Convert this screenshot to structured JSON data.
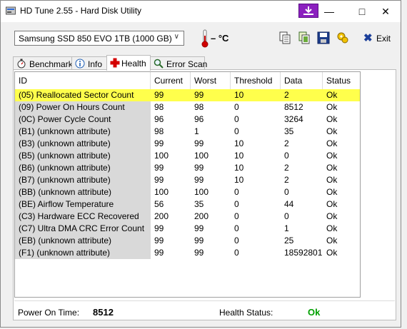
{
  "window": {
    "title": "HD Tune 2.55 - Hard Disk Utility"
  },
  "toolbar": {
    "drive": "Samsung SSD 850 EVO 1TB (1000 GB)",
    "temperature": "– °C",
    "exit_label": "Exit"
  },
  "tabs": [
    {
      "label": "Benchmark",
      "icon": "stopwatch-icon"
    },
    {
      "label": "Info",
      "icon": "info-icon"
    },
    {
      "label": "Health",
      "icon": "red-cross-icon",
      "active": true
    },
    {
      "label": "Error Scan",
      "icon": "magnifier-icon"
    }
  ],
  "table": {
    "headers": [
      "ID",
      "Current",
      "Worst",
      "Threshold",
      "Data",
      "Status"
    ],
    "rows": [
      {
        "id": "(05) Reallocated Sector Count",
        "current": "99",
        "worst": "99",
        "threshold": "10",
        "data": "2",
        "status": "Ok",
        "highlighted": true
      },
      {
        "id": "(09) Power On Hours Count",
        "current": "98",
        "worst": "98",
        "threshold": "0",
        "data": "8512",
        "status": "Ok"
      },
      {
        "id": "(0C) Power Cycle Count",
        "current": "96",
        "worst": "96",
        "threshold": "0",
        "data": "3264",
        "status": "Ok"
      },
      {
        "id": "(B1) (unknown attribute)",
        "current": "98",
        "worst": "1",
        "threshold": "0",
        "data": "35",
        "status": "Ok"
      },
      {
        "id": "(B3) (unknown attribute)",
        "current": "99",
        "worst": "99",
        "threshold": "10",
        "data": "2",
        "status": "Ok"
      },
      {
        "id": "(B5) (unknown attribute)",
        "current": "100",
        "worst": "100",
        "threshold": "10",
        "data": "0",
        "status": "Ok"
      },
      {
        "id": "(B6) (unknown attribute)",
        "current": "99",
        "worst": "99",
        "threshold": "10",
        "data": "2",
        "status": "Ok"
      },
      {
        "id": "(B7) (unknown attribute)",
        "current": "99",
        "worst": "99",
        "threshold": "10",
        "data": "2",
        "status": "Ok"
      },
      {
        "id": "(BB) (unknown attribute)",
        "current": "100",
        "worst": "100",
        "threshold": "0",
        "data": "0",
        "status": "Ok"
      },
      {
        "id": "(BE) Airflow Temperature",
        "current": "56",
        "worst": "35",
        "threshold": "0",
        "data": "44",
        "status": "Ok"
      },
      {
        "id": "(C3) Hardware ECC Recovered",
        "current": "200",
        "worst": "200",
        "threshold": "0",
        "data": "0",
        "status": "Ok"
      },
      {
        "id": "(C7) Ultra DMA CRC Error Count",
        "current": "99",
        "worst": "99",
        "threshold": "0",
        "data": "1",
        "status": "Ok"
      },
      {
        "id": "(EB) (unknown attribute)",
        "current": "99",
        "worst": "99",
        "threshold": "0",
        "data": "25",
        "status": "Ok"
      },
      {
        "id": "(F1) (unknown attribute)",
        "current": "99",
        "worst": "99",
        "threshold": "0",
        "data": "18592801",
        "status": "Ok"
      }
    ]
  },
  "footer": {
    "power_on_label": "Power On Time:",
    "power_on_value": "8512",
    "health_label": "Health Status:",
    "health_value": "Ok"
  },
  "colors": {
    "highlight": "#ffff4c",
    "id_column_bg": "#d9d9d9",
    "health_ok": "#00a000"
  }
}
